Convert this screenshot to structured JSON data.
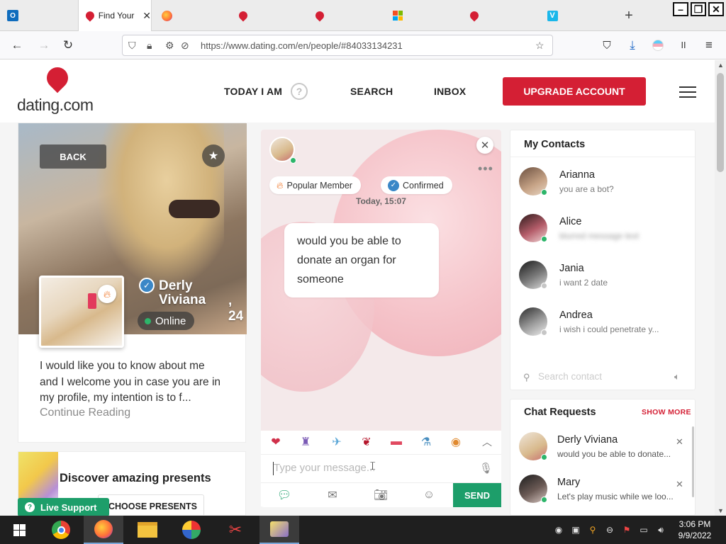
{
  "browser": {
    "tabs": [
      {
        "icon": "outlook-icon"
      },
      {
        "title": "Find Your",
        "icon": "dating-heart-icon",
        "active": true
      },
      {
        "icon": "firefox-icon"
      },
      {
        "icon": "dating-heart-icon"
      },
      {
        "icon": "dating-heart-icon"
      },
      {
        "icon": "microsoft-icon"
      },
      {
        "icon": "dating-heart-icon"
      },
      {
        "icon": "v-icon"
      }
    ],
    "new_tab": "+",
    "url": "https://www.dating.com/en/people/#84033134231"
  },
  "header": {
    "logo": "dating.com",
    "menu": {
      "today": "TODAY I AM",
      "search": "SEARCH",
      "inbox": "INBOX"
    },
    "help": "?",
    "upgrade": "UPGRADE ACCOUNT"
  },
  "profile": {
    "back": "BACK",
    "name": "Derly Viviana",
    "age": ", 24",
    "status": "Online",
    "bio": "I would like you to know about me and I welcome you in case you are in my profile, my intention is to f...",
    "continue": "Continue Reading"
  },
  "presents": {
    "title": "Discover amazing presents",
    "button": "CHOOSE PRESENTS"
  },
  "live_support": "Live Support",
  "chat": {
    "badges": {
      "popular": "Popular Member",
      "confirmed": "Confirmed"
    },
    "timestamp": "Today, 15:07",
    "message": "would you be able to donate an organ for someone",
    "input_placeholder": "Type your message...",
    "send": "SEND"
  },
  "contacts": {
    "title": "My Contacts",
    "items": [
      {
        "name": "Arianna",
        "last": "you are a bot?",
        "online": true
      },
      {
        "name": "Alice",
        "last": "blurred message text",
        "online": true,
        "blurred": true
      },
      {
        "name": "Jania",
        "last": "i want 2 date",
        "online": false
      },
      {
        "name": "Andrea",
        "last": "i wish i could penetrate y...",
        "online": false
      }
    ],
    "search_placeholder": "Search contact"
  },
  "requests": {
    "title": "Chat Requests",
    "show_more": "SHOW MORE",
    "items": [
      {
        "name": "Derly Viviana",
        "last": "would you be able to donate..."
      },
      {
        "name": "Mary",
        "last": "Let's play music while we loo..."
      }
    ]
  },
  "taskbar": {
    "time": "3:06 PM",
    "date": "9/9/2022"
  },
  "colors": {
    "brand": "#d41f34",
    "accent_green": "#1d9e6a",
    "verified_blue": "#3a87c7"
  }
}
